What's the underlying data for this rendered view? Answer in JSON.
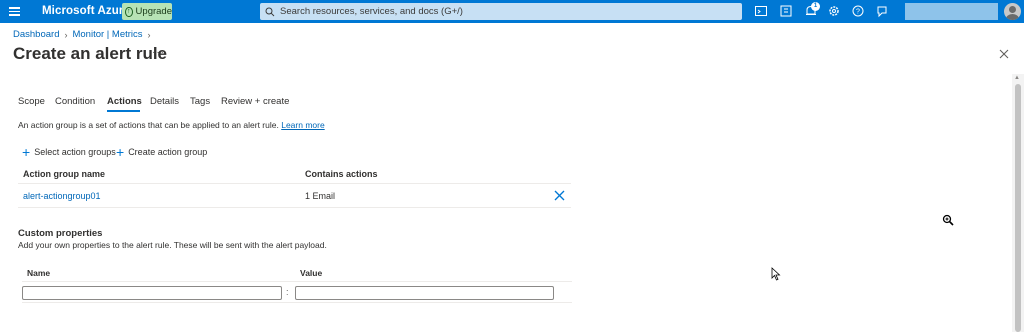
{
  "topbar": {
    "brand": "Microsoft Azure",
    "upgrade_label": "Upgrade",
    "search_placeholder": "Search resources, services, and docs (G+/)",
    "notification_count": "1",
    "accent": "#0078d4"
  },
  "breadcrumb": {
    "items": [
      "Dashboard",
      "Monitor | Metrics"
    ]
  },
  "page": {
    "title": "Create an alert rule",
    "more_label": "···"
  },
  "tabs": [
    {
      "label": "Scope"
    },
    {
      "label": "Condition"
    },
    {
      "label": "Actions",
      "active": true
    },
    {
      "label": "Details"
    },
    {
      "label": "Tags"
    },
    {
      "label": "Review + create"
    }
  ],
  "actions": {
    "description": "An action group is a set of actions that can be applied to an alert rule.",
    "learn_more": "Learn more",
    "select_label": "Select action groups",
    "create_label": "Create action group",
    "columns": [
      "Action group name",
      "Contains actions"
    ],
    "rows": [
      {
        "name": "alert-actiongroup01",
        "actions": "1 Email"
      }
    ]
  },
  "custom_properties": {
    "title": "Custom properties",
    "description": "Add your own properties to the alert rule. These will be sent with the alert payload.",
    "columns": [
      "Name",
      "Value"
    ],
    "separator": ":"
  },
  "icons": [
    "hamburger-icon",
    "upgrade-icon",
    "search-icon",
    "cloud-shell-icon",
    "directory-filter-icon",
    "notifications-icon",
    "settings-icon",
    "help-icon",
    "feedback-icon",
    "close-icon",
    "plus-icon",
    "delete-icon",
    "zoom-icon",
    "cursor-icon"
  ]
}
